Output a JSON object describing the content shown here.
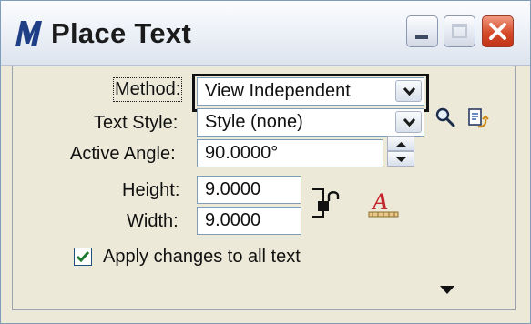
{
  "window": {
    "title": "Place Text"
  },
  "form": {
    "method_label": "Method:",
    "method_value": "View Independent",
    "text_style_label": "Text Style:",
    "text_style_value": "Style (none)",
    "active_angle_label": "Active Angle:",
    "active_angle_value": "90.0000°",
    "height_label": "Height:",
    "height_value": "9.0000",
    "width_label": "Width:",
    "width_value": "9.0000",
    "apply_changes_label": "Apply changes to all text",
    "apply_changes_checked": true
  },
  "icons": {
    "app": "microstation-m-icon",
    "minimize": "minimize-icon",
    "maximize": "maximize-icon",
    "close": "close-icon",
    "search": "search-icon",
    "browse": "browse-text-style-icon",
    "lock": "lock-height-width-icon",
    "text_style_picker": "text-style-picker-icon",
    "expand": "chevron-down-icon"
  },
  "colors": {
    "title_close": "#d54a2a",
    "checkmark": "#1b7a2e",
    "text_style_icon": "#c4262e"
  }
}
